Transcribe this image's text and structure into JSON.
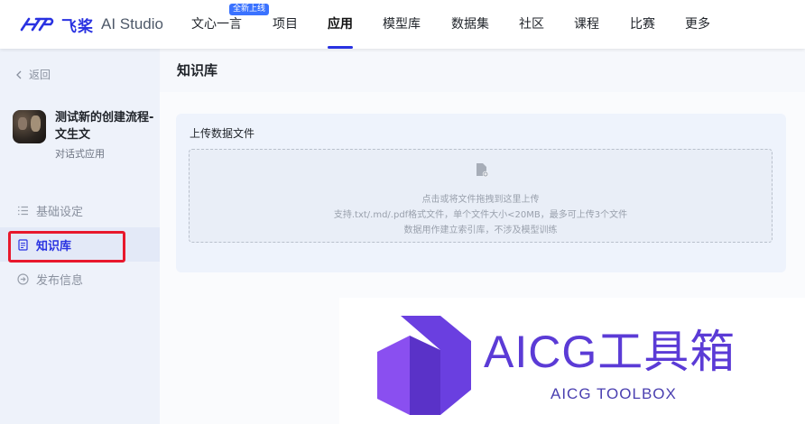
{
  "brand": {
    "name_cn": "飞桨",
    "name_en": "AI Studio",
    "accent": "#2932e1"
  },
  "nav": {
    "badge": "全新上线",
    "items": [
      {
        "label": "文心一言"
      },
      {
        "label": "项目"
      },
      {
        "label": "应用",
        "active": true
      },
      {
        "label": "模型库"
      },
      {
        "label": "数据集"
      },
      {
        "label": "社区"
      },
      {
        "label": "课程"
      },
      {
        "label": "比赛"
      },
      {
        "label": "更多"
      }
    ]
  },
  "sidebar": {
    "back_label": "返回",
    "app": {
      "name": "测试新的创建流程-文生文",
      "type": "对话式应用"
    },
    "items": [
      {
        "label": "基础设定",
        "icon": "list-icon"
      },
      {
        "label": "知识库",
        "icon": "document-icon",
        "active": true
      },
      {
        "label": "发布信息",
        "icon": "arrow-circle-icon"
      }
    ],
    "highlight_color": "#e8182c"
  },
  "main": {
    "title": "知识库",
    "upload": {
      "label": "上传数据文件",
      "icon": "file-add-icon",
      "line1": "点击或将文件拖拽到这里上传",
      "line2": "支持.txt/.md/.pdf格式文件，单个文件大小<20MB，最多可上传3个文件",
      "line3": "数据用作建立索引库，不涉及模型训练"
    }
  },
  "watermark": {
    "title": "AICG工具箱",
    "subtitle": "AICG TOOLBOX",
    "color": "#5b3bd6"
  }
}
